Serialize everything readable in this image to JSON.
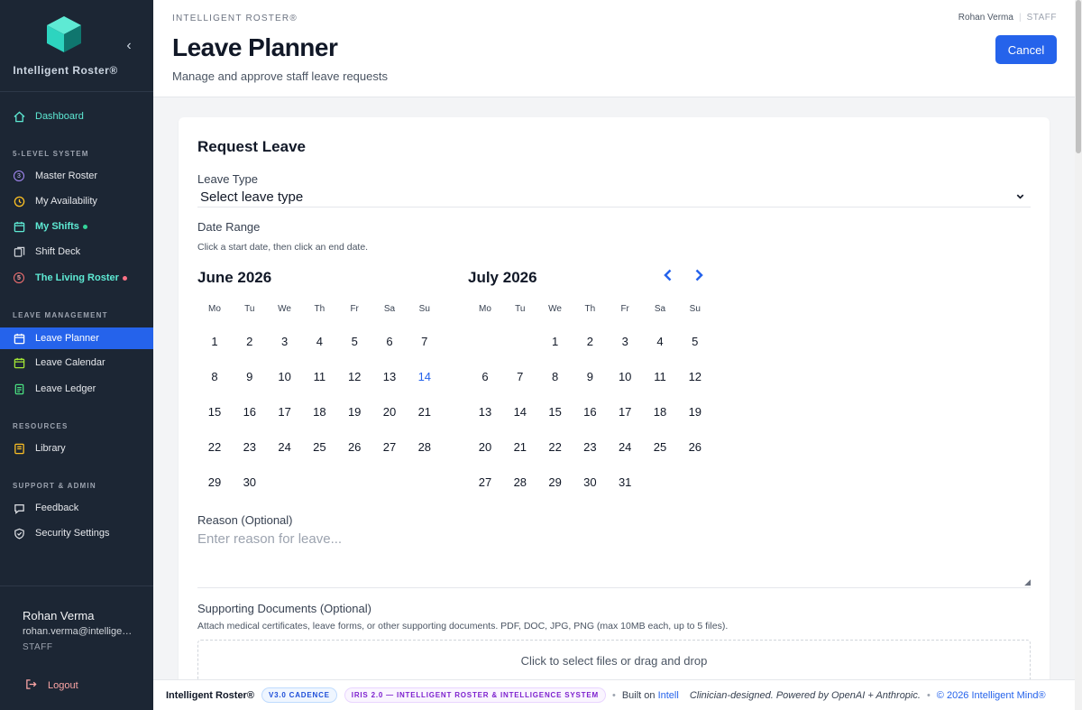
{
  "sidebar": {
    "brand": "Intelligent Roster®",
    "colors": {
      "active": "#2563eb",
      "teal": "#5eead4"
    },
    "nav_top": [
      {
        "label": "Dashboard",
        "icon": "home-icon"
      }
    ],
    "sections": [
      {
        "label": "5-LEVEL SYSTEM",
        "items": [
          {
            "label": "Master Roster",
            "icon": "level-3-badge",
            "badge": "3"
          },
          {
            "label": "My Availability",
            "icon": "clock-icon"
          },
          {
            "label": "My Shifts",
            "icon": "calendar-icon"
          },
          {
            "label": "Shift Deck",
            "icon": "cards-icon"
          },
          {
            "label": "The Living Roster",
            "icon": "level-5-badge",
            "badge": "5"
          }
        ]
      },
      {
        "label": "LEAVE MANAGEMENT",
        "items": [
          {
            "label": "Leave Planner",
            "icon": "calendar-icon"
          },
          {
            "label": "Leave Calendar",
            "icon": "calendar-icon"
          },
          {
            "label": "Leave Ledger",
            "icon": "ledger-icon"
          }
        ]
      },
      {
        "label": "RESOURCES",
        "items": [
          {
            "label": "Library",
            "icon": "book-icon"
          }
        ]
      },
      {
        "label": "SUPPORT & ADMIN",
        "items": [
          {
            "label": "Feedback",
            "icon": "chat-icon"
          },
          {
            "label": "Security Settings",
            "icon": "shield-icon"
          }
        ]
      }
    ],
    "user": {
      "name": "Rohan Verma",
      "email": "rohan.verma@intelligentroster",
      "role": "STAFF"
    },
    "logout": "Logout"
  },
  "header": {
    "crumb": "INTELLIGENT ROSTER®",
    "title": "Leave Planner",
    "subtitle": "Manage and approve staff leave requests",
    "user_name": "Rohan Verma",
    "user_role": "STAFF",
    "cancel": "Cancel"
  },
  "form": {
    "title": "Request Leave",
    "leave_type_label": "Leave Type",
    "leave_type_value": "Select leave type",
    "date_range_label": "Date Range",
    "date_hint": "Click a start date, then click an end date.",
    "weekdays": [
      "Mo",
      "Tu",
      "We",
      "Th",
      "Fr",
      "Sa",
      "Su"
    ],
    "months": [
      {
        "title": "June 2026",
        "offset": 0,
        "days": 30,
        "today": 14
      },
      {
        "title": "July 2026",
        "offset": 2,
        "days": 31,
        "today": null
      }
    ],
    "reason_label": "Reason (Optional)",
    "reason_placeholder": "Enter reason for leave...",
    "docs_label": "Supporting Documents (Optional)",
    "docs_hint": "Attach medical certificates, leave forms, or other supporting documents. PDF, DOC, JPG, PNG (max 10MB each, up to 5 files).",
    "dropzone": "Click to select files or drag and drop"
  },
  "footer": {
    "brand": "Intelligent Roster®",
    "version": "V3.0 CADENCE",
    "iris": "IRIS 2.0 — INTELLIGENT ROSTER & INTELLIGENCE SYSTEM",
    "built_on": "Built on",
    "built_link": "Intell",
    "tagline": "Clinician-designed. Powered by OpenAI + Anthropic.",
    "copyright": "© 2026 Intelligent Mind®"
  }
}
